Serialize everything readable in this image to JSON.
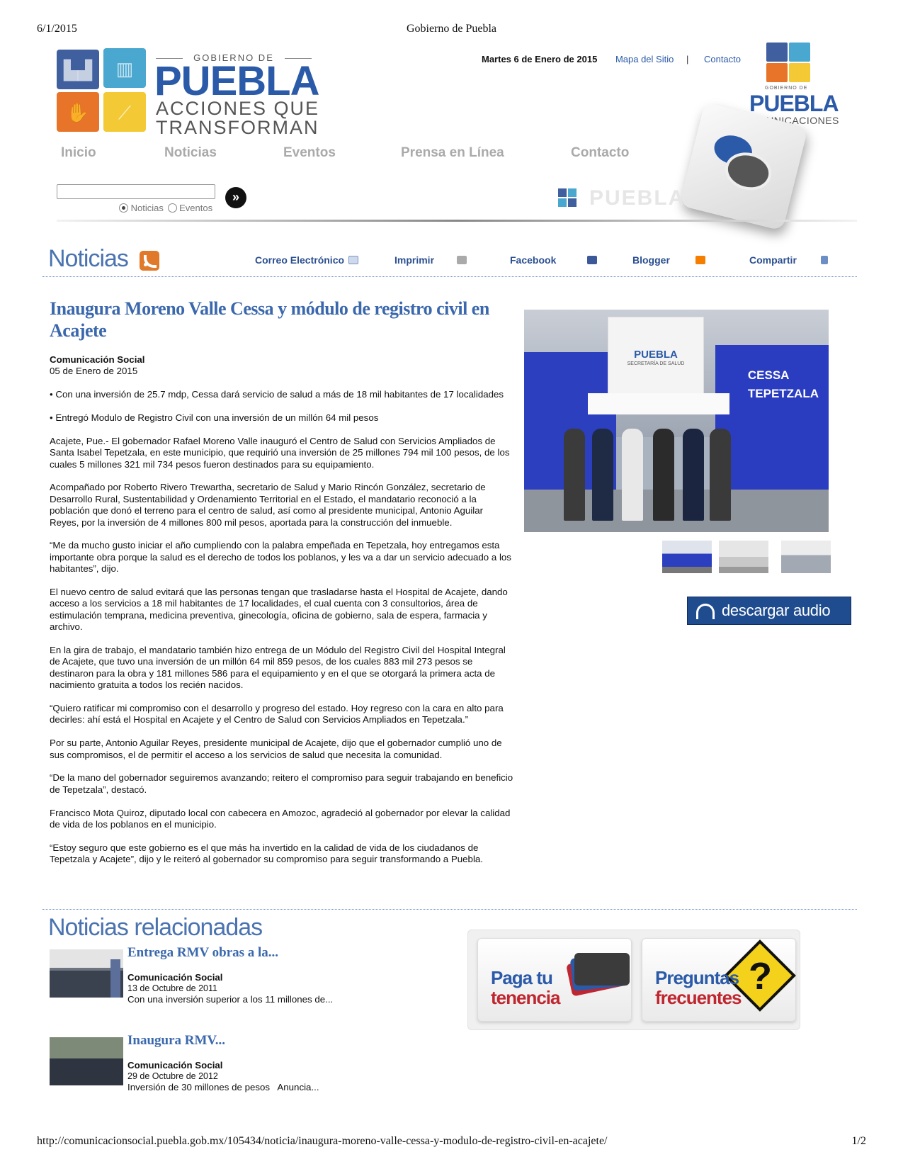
{
  "print": {
    "date": "6/1/2015",
    "title": "Gobierno de Puebla",
    "url": "http://comunicacionsocial.puebla.gob.mx/105434/noticia/inaugura-moreno-valle-cessa-y-modulo-de-registro-civil-en-acajete/",
    "page": "1/2"
  },
  "brand": {
    "gobierno_de": "GOBIERNO DE",
    "name": "PUEBLA",
    "slogan_1": "ACCIONES QUE",
    "slogan_2": "TRANSFORMAN",
    "com_gobierno": "GOBIERNO DE",
    "com_name": "PUEBLA",
    "com_sub": "COMUNICACIONES",
    "watermark": "PUEBLA",
    "colors": {
      "blue": "#2a5aa8",
      "navy": "#3f5f9e",
      "cyan": "#4aa7cf",
      "orange": "#e8742a",
      "yellow": "#f3c935"
    }
  },
  "topbar": {
    "today": "Martes 6 de Enero de 2015",
    "sitemap": "Mapa del Sitio",
    "separator": "|",
    "contact": "Contacto"
  },
  "nav": [
    "Inicio",
    "Noticias",
    "Eventos",
    "Prensa en Línea",
    "Contacto"
  ],
  "search": {
    "value": "",
    "go_icon": "»",
    "options": [
      "Noticias",
      "Eventos"
    ],
    "selected": "Noticias"
  },
  "section": {
    "title": "Noticias",
    "share": [
      "Correo Electrónico",
      "Imprimir",
      "Facebook",
      "Blogger",
      "Compartir"
    ]
  },
  "article": {
    "headline": "Inaugura Moreno Valle Cessa y módulo de registro civil en Acajete",
    "author": "Comunicación Social",
    "date": "05 de Enero de 2015",
    "paragraphs": [
      "• Con una inversión de 25.7 mdp, Cessa dará servicio de salud a más de 18 mil habitantes de 17 localidades",
      "• Entregó Modulo de Registro Civil con una inversión de un millón 64 mil pesos",
      "Acajete, Pue.- El gobernador Rafael Moreno Valle inauguró el Centro de Salud con Servicios Ampliados de Santa Isabel Tepetzala, en este municipio, que requirió una inversión de 25 millones 794 mil 100 pesos, de los cuales 5 millones 321 mil 734 pesos fueron destinados para su equipamiento.",
      "Acompañado por Roberto Rivero Trewartha, secretario de Salud y Mario Rincón González, secretario de Desarrollo Rural, Sustentabilidad y Ordenamiento Territorial en el Estado, el mandatario reconoció a la población que donó el terreno para el centro de salud, así como al presidente municipal, Antonio Aguilar Reyes, por la inversión de 4 millones 800 mil pesos, aportada para la construcción del inmueble.",
      "“Me da mucho gusto iniciar el año cumpliendo con la palabra empeñada en Tepetzala,  hoy entregamos esta importante obra porque la salud es el derecho de todos los poblanos, y les va a dar un servicio adecuado a los habitantes”, dijo.",
      "El nuevo centro de salud evitará que las personas tengan que trasladarse hasta el Hospital de Acajete, dando acceso a los servicios a 18 mil habitantes de 17 localidades, el cual cuenta con 3 consultorios, área de estimulación temprana, medicina preventiva,  ginecología, oficina de gobierno, sala de espera, farmacia y archivo.",
      "En la gira de trabajo, el mandatario también hizo entrega de un Módulo del Registro Civil del Hospital Integral de Acajete, que tuvo una inversión de un millón 64 mil 859 pesos,  de los cuales 883 mil 273 pesos se destinaron para la obra y 181 millones 586 para el equipamiento y en el que se otorgará la primera acta de nacimiento gratuita a todos los recién nacidos.",
      "“Quiero ratificar mi compromiso con el desarrollo y progreso del estado. Hoy regreso con la cara en alto para decirles: ahí está el Hospital en Acajete y el Centro de Salud con Servicios Ampliados en Tepetzala.”",
      "Por su parte, Antonio Aguilar Reyes, presidente municipal de Acajete, dijo que el gobernador cumplió uno de sus compromisos, el de permitir el acceso a los servicios de salud que necesita la comunidad.",
      "“De la mano del gobernador seguiremos avanzando; reitero el compromiso para seguir trabajando en beneficio de Tepetzala”, destacó.",
      "Francisco Mota Quiroz, diputado local con cabecera en Amozoc, agradeció al gobernador por elevar la calidad de vida de los poblanos en el municipio.",
      "“Estoy seguro que este gobierno es el que más ha invertido en la calidad de vida de los ciudadanos de Tepetzala y Acajete”, dijo y le reiteró al gobernador  su compromiso para seguir transformando a Puebla."
    ],
    "photo": {
      "sign_brand": "PUEBLA",
      "sign_sub": "SECRETARÍA DE SALUD",
      "building_1": "CESSA",
      "building_2": "TEPETZALA"
    },
    "audio_label": "descargar audio"
  },
  "related": {
    "title": "Noticias relacionadas",
    "items": [
      {
        "title": "Entrega RMV obras a la...",
        "author": "Comunicación Social",
        "date": "13 de Octubre de 2011",
        "summary": "Con una inversión superior a los 11 millones de..."
      },
      {
        "title": "Inaugura RMV...",
        "author": "Comunicación Social",
        "date": "29 de Octubre de 2012",
        "summary": "Inversión de 30 millones de pesos   Anuncia..."
      }
    ]
  },
  "banners": {
    "tenencia_1": "Paga tu",
    "tenencia_2": "tenencia",
    "faq_1": "Preguntas",
    "faq_2": "frecuentes"
  }
}
